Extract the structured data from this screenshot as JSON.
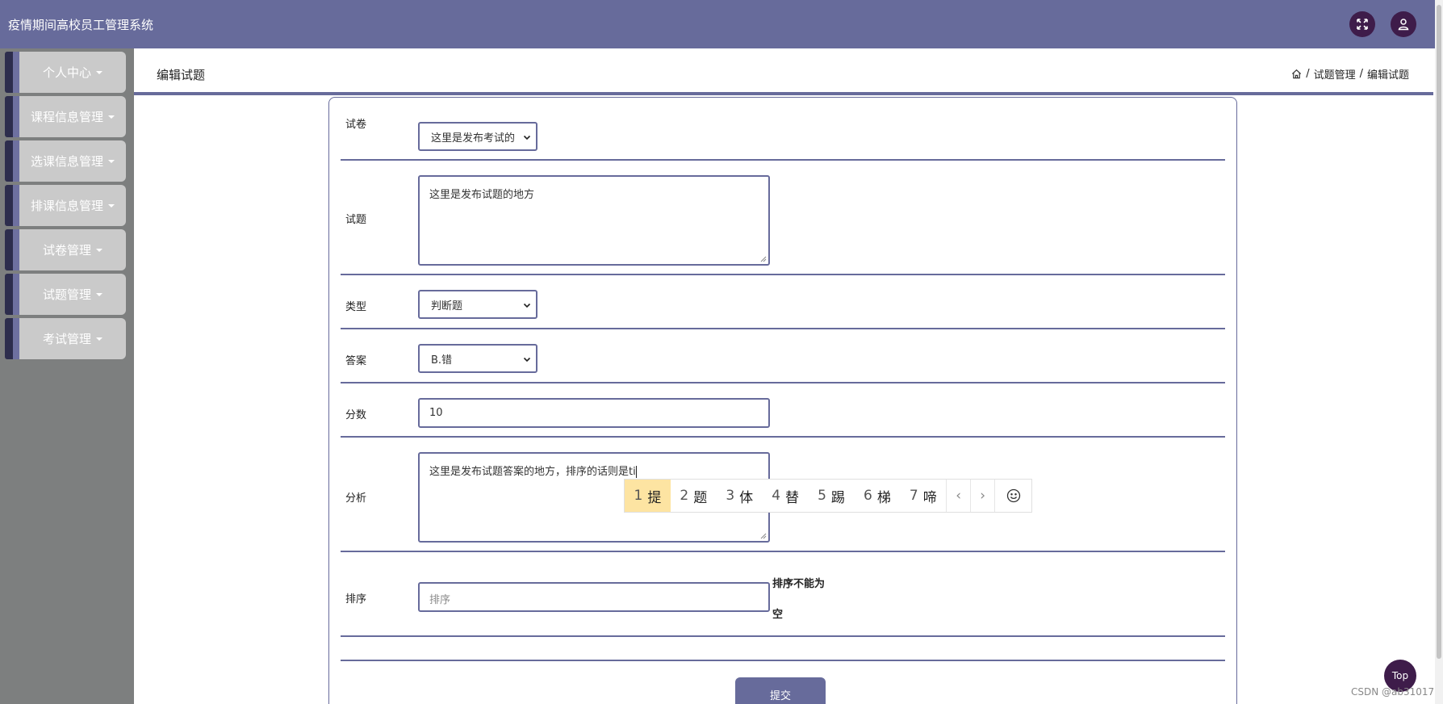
{
  "app": {
    "title": "疫情期间高校员工管理系统"
  },
  "header": {
    "fullscreen_icon": "expand-arrows-icon",
    "user_icon": "user-icon"
  },
  "sidebar": {
    "items": [
      {
        "label": "个人中心"
      },
      {
        "label": "课程信息管理"
      },
      {
        "label": "选课信息管理"
      },
      {
        "label": "排课信息管理"
      },
      {
        "label": "试卷管理"
      },
      {
        "label": "试题管理"
      },
      {
        "label": "考试管理"
      }
    ]
  },
  "page": {
    "title": "编辑试题",
    "breadcrumb": [
      "试题管理",
      "编辑试题"
    ],
    "breadcrumb_sep": "/"
  },
  "form": {
    "paper": {
      "label": "试卷",
      "value": "这里是发布考试的"
    },
    "question": {
      "label": "试题",
      "value": "这里是发布试题的地方"
    },
    "type": {
      "label": "类型",
      "value": "判断题"
    },
    "answer": {
      "label": "答案",
      "value": "B.错"
    },
    "score": {
      "label": "分数",
      "value": "10"
    },
    "analysis": {
      "label": "分析",
      "value": "这里是发布试题答案的地方，排序的话则是ti"
    },
    "order": {
      "label": "排序",
      "placeholder": "排序",
      "error_line1": "排序不能为",
      "error_line2": "空"
    },
    "submit_label": "提交"
  },
  "ime": {
    "candidates": [
      {
        "num": "1",
        "char": "提"
      },
      {
        "num": "2",
        "char": "题"
      },
      {
        "num": "3",
        "char": "体"
      },
      {
        "num": "4",
        "char": "替"
      },
      {
        "num": "5",
        "char": "踢"
      },
      {
        "num": "6",
        "char": "梯"
      },
      {
        "num": "7",
        "char": "啼"
      }
    ],
    "prev": "‹",
    "next": "›"
  },
  "top_button": "Top",
  "watermark": "CSDN @ab31017",
  "colors": {
    "accent": "#676b9b",
    "dark": "#3e1c4a",
    "sidebar_bg": "#7d7f7f",
    "ime_highlight": "#fde4a2"
  }
}
